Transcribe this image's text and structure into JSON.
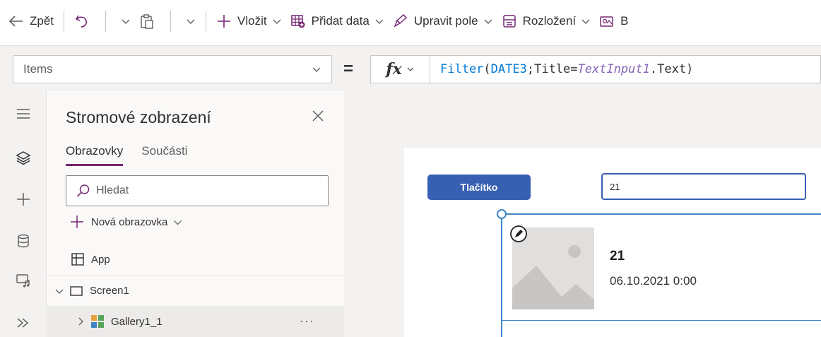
{
  "toolbar": {
    "back_label": "Zpět",
    "insert_label": "Vložit",
    "add_data_label": "Přidat data",
    "edit_fields_label": "Upravit pole",
    "layout_label": "Rozložení",
    "truncated_label": "B"
  },
  "formula_bar": {
    "property": "Items",
    "equals": "=",
    "fx": "fx",
    "formula": {
      "fn": "Filter",
      "open": "(",
      "datasource": "DATE3",
      "middle": ";Title=",
      "control": "TextInput1",
      "tail": ".Text)"
    }
  },
  "tree": {
    "title": "Stromové zobrazení",
    "tabs": [
      "Obrazovky",
      "Součásti"
    ],
    "search_placeholder": "Hledat",
    "new_screen_label": "Nová obrazovka",
    "nodes": {
      "app": "App",
      "screen": "Screen1",
      "gallery": "Gallery1_1",
      "more": "···"
    }
  },
  "canvas": {
    "button_label": "Tlačítko",
    "text_input_value": "21",
    "gallery_item": {
      "title": "21",
      "subtitle": "06.10.2021 0:00"
    }
  },
  "colors": {
    "accent": "#742774",
    "button_fill": "#3860b2",
    "selection": "#3d85c6",
    "formula_function": "#0078d4",
    "formula_control": "#8764b8"
  }
}
